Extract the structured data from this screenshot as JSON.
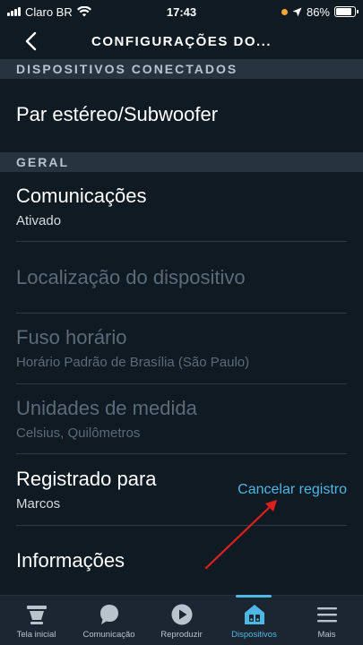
{
  "status_bar": {
    "carrier": "Claro BR",
    "time": "17:43",
    "battery": "86%",
    "battery_level": 0.86
  },
  "header": {
    "title": "CONFIGURAÇÕES DO..."
  },
  "sections": {
    "connected": {
      "label": "DISPOSITIVOS CONECTADOS"
    },
    "general": {
      "label": "GERAL"
    }
  },
  "rows": {
    "stereo": {
      "title": "Par estéreo/Subwoofer"
    },
    "communications": {
      "title": "Comunicações",
      "subtitle": "Ativado"
    },
    "location": {
      "title": "Localização do dispositivo"
    },
    "timezone": {
      "title": "Fuso horário",
      "subtitle": "Horário Padrão de Brasília (São Paulo)"
    },
    "units": {
      "title": "Unidades de medida",
      "subtitle": "Celsius, Quilômetros"
    },
    "registered": {
      "title": "Registrado para",
      "subtitle": "Marcos",
      "action": "Cancelar registro"
    },
    "info": {
      "title": "Informações"
    }
  },
  "bottom_nav": {
    "home": "Tela inicial",
    "communicate": "Comunicação",
    "play": "Reproduzir",
    "devices": "Dispositivos",
    "more": "Mais"
  },
  "colors": {
    "background": "#0f1a23",
    "section_bg": "#273440",
    "accent": "#4fb7e6",
    "disabled_text": "#5b6b78",
    "annotation_arrow": "#e0201c"
  }
}
